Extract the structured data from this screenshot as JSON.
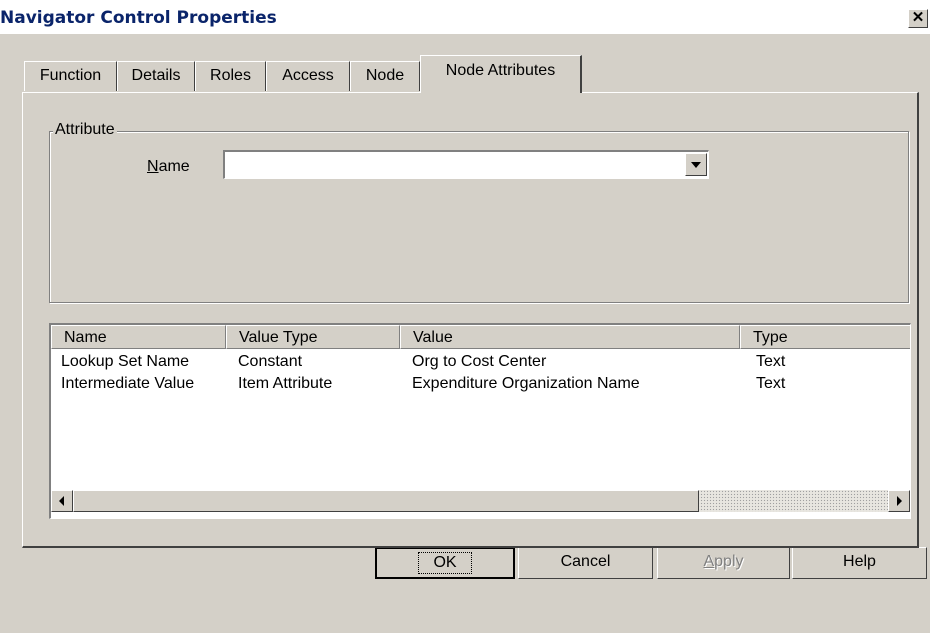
{
  "window": {
    "title": "Navigator Control Properties",
    "close_glyph": "✕"
  },
  "tabs": [
    {
      "label": "Function",
      "active": false
    },
    {
      "label": "Details",
      "active": false
    },
    {
      "label": "Roles",
      "active": false
    },
    {
      "label": "Access",
      "active": false
    },
    {
      "label": "Node",
      "active": false
    },
    {
      "label": "Node Attributes",
      "active": true
    }
  ],
  "attribute_group": {
    "legend": "Attribute",
    "name_label": "Name",
    "name_value": ""
  },
  "table": {
    "columns": [
      "Name",
      "Value Type",
      "Value",
      "Type"
    ],
    "rows": [
      [
        "Lookup Set Name",
        "Constant",
        "Org to Cost Center",
        "Text"
      ],
      [
        "Intermediate Value",
        "Item Attribute",
        "Expenditure Organization Name",
        "Text"
      ]
    ]
  },
  "buttons": {
    "ok": "OK",
    "cancel": "Cancel",
    "apply": "Apply",
    "help": "Help"
  },
  "icons": {
    "close": "close-icon",
    "dropdown": "chevron-down-icon",
    "scroll_left": "arrow-left-icon",
    "scroll_right": "arrow-right-icon"
  },
  "colors": {
    "title_text": "#0a246a",
    "face": "#d4d0c8",
    "disabled_text": "#808080"
  }
}
